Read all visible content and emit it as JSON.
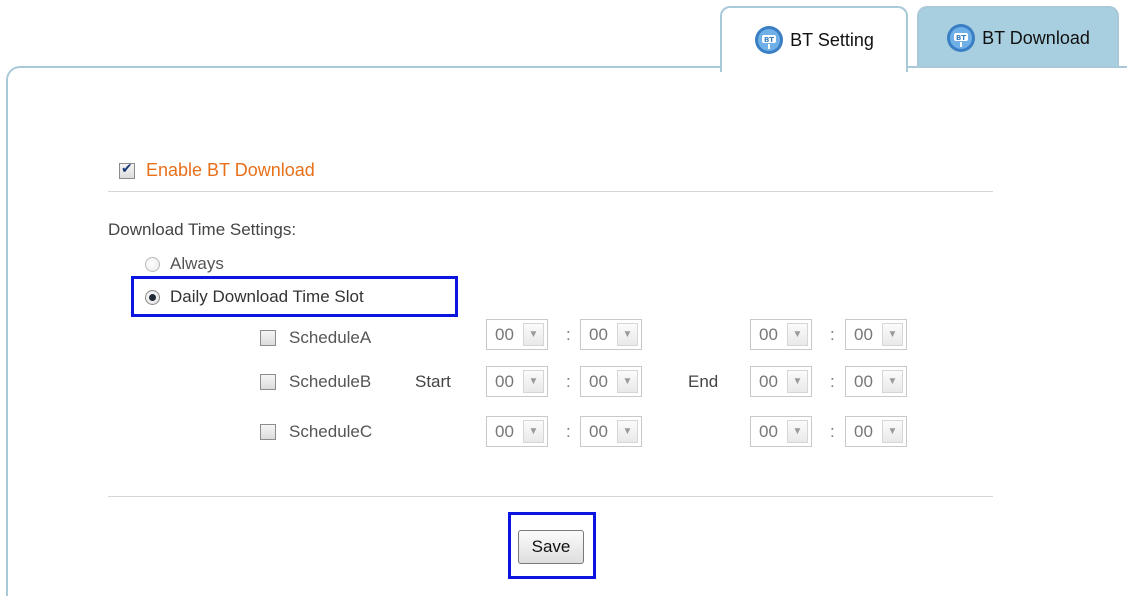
{
  "tabs": [
    {
      "label": "BT Setting",
      "icon": "bt-icon",
      "active": true
    },
    {
      "label": "BT Download",
      "icon": "bt-icon",
      "active": false
    }
  ],
  "enable": {
    "label": "Enable BT Download",
    "checked": true
  },
  "download_time": {
    "title": "Download Time Settings:",
    "options": [
      {
        "label": "Always",
        "selected": false
      },
      {
        "label": "Daily Download Time Slot",
        "selected": true
      }
    ]
  },
  "schedule": {
    "start_label": "Start",
    "end_label": "End",
    "separator": ":",
    "rows": [
      {
        "label": "ScheduleA",
        "checked": false,
        "start_hour": "00",
        "start_min": "00",
        "end_hour": "00",
        "end_min": "00"
      },
      {
        "label": "ScheduleB",
        "checked": false,
        "start_hour": "00",
        "start_min": "00",
        "end_hour": "00",
        "end_min": "00"
      },
      {
        "label": "ScheduleC",
        "checked": false,
        "start_hour": "00",
        "start_min": "00",
        "end_hour": "00",
        "end_min": "00"
      }
    ]
  },
  "save_label": "Save",
  "colors": {
    "accent_orange": "#e8701a",
    "tab_border": "#a9c9d8",
    "tab_inactive_bg": "#a8cfdf",
    "highlight": "#0a16e0"
  }
}
